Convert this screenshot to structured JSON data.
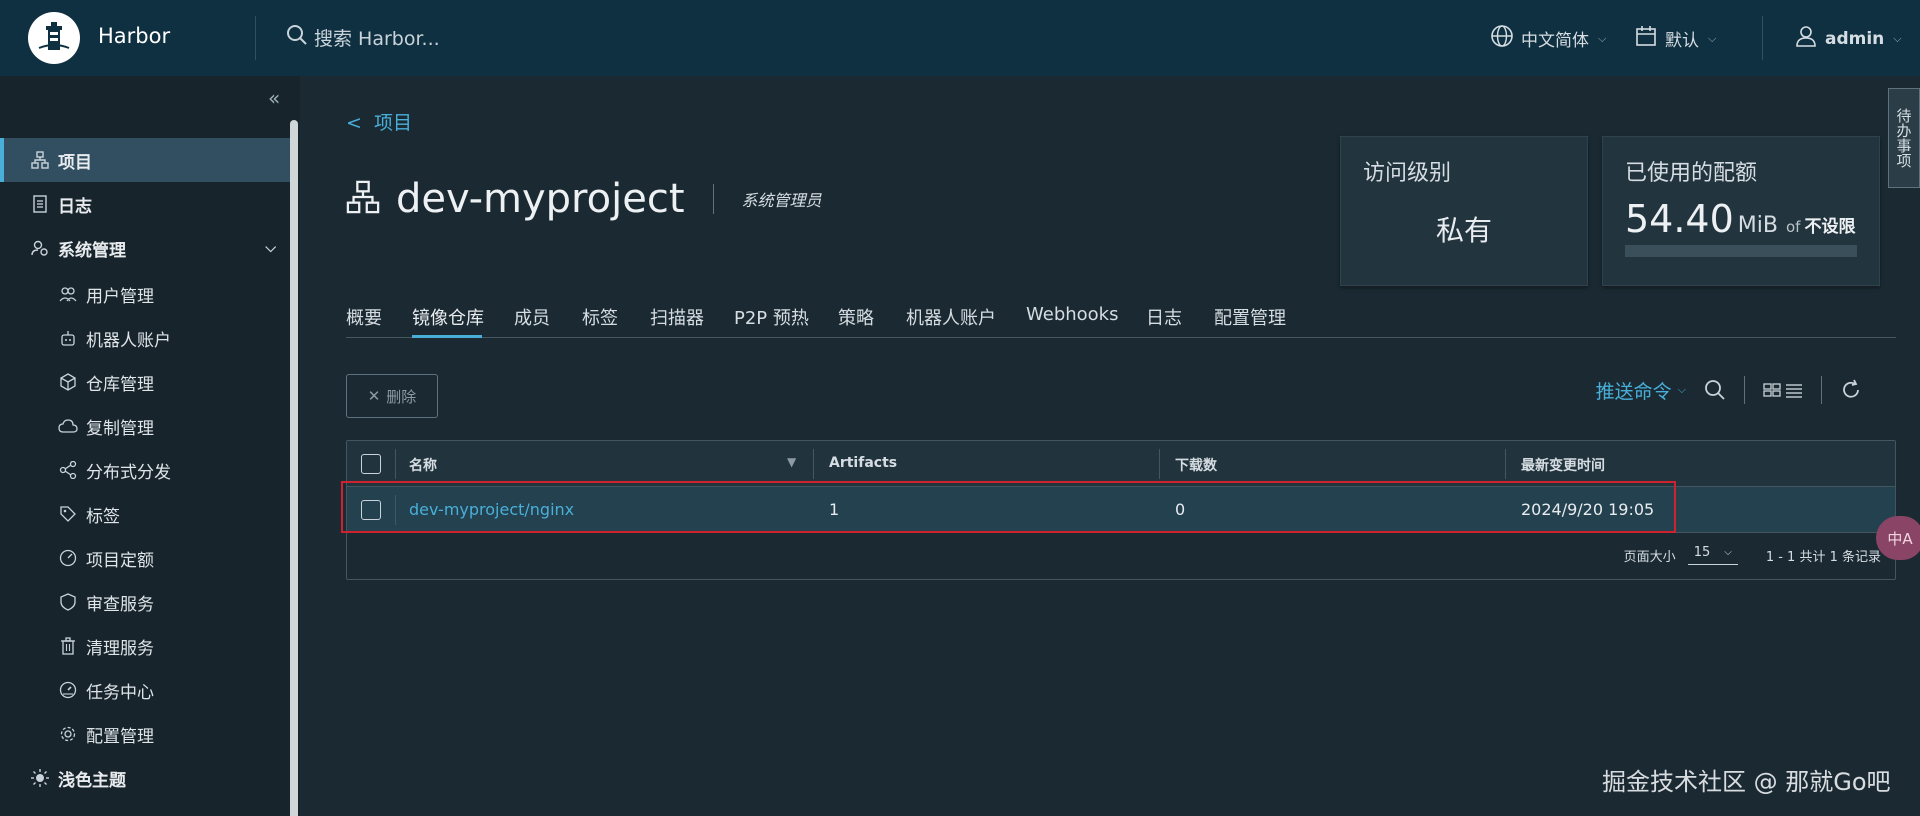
{
  "header": {
    "app_title": "Harbor",
    "search_placeholder": "搜索 Harbor...",
    "language": "中文简体",
    "datetime_format": "默认",
    "user": "admin"
  },
  "sidebar": {
    "items": [
      {
        "label": "项目",
        "icon": "project-icon"
      },
      {
        "label": "日志",
        "icon": "log-icon"
      },
      {
        "label": "系统管理",
        "icon": "system-admin-icon"
      },
      {
        "label": "用户管理",
        "icon": "users-icon"
      },
      {
        "label": "机器人账户",
        "icon": "robot-icon"
      },
      {
        "label": "仓库管理",
        "icon": "registry-icon"
      },
      {
        "label": "复制管理",
        "icon": "replication-icon"
      },
      {
        "label": "分布式分发",
        "icon": "distribution-icon"
      },
      {
        "label": "标签",
        "icon": "tag-icon"
      },
      {
        "label": "项目定额",
        "icon": "quota-icon"
      },
      {
        "label": "审查服务",
        "icon": "shield-icon"
      },
      {
        "label": "清理服务",
        "icon": "trash-icon"
      },
      {
        "label": "任务中心",
        "icon": "dashboard-icon"
      },
      {
        "label": "配置管理",
        "icon": "gear-icon"
      },
      {
        "label": "浅色主题",
        "icon": "sun-icon"
      }
    ]
  },
  "main": {
    "breadcrumb": "项目",
    "project_name": "dev-myproject",
    "role": "系统管理员",
    "access_card": {
      "title": "访问级别",
      "value": "私有"
    },
    "quota_card": {
      "title": "已使用的配额",
      "used": "54.40",
      "unit": "MiB",
      "of": "of",
      "limit": "不设限"
    },
    "tabs": [
      "概要",
      "镜像仓库",
      "成员",
      "标签",
      "扫描器",
      "P2P 预热",
      "策略",
      "机器人账户",
      "Webhooks",
      "日志",
      "配置管理"
    ],
    "active_tab": "镜像仓库",
    "delete_label": "删除",
    "push_command_label": "推送命令",
    "grid": {
      "columns": [
        "名称",
        "Artifacts",
        "下载数",
        "最新变更时间"
      ],
      "rows": [
        {
          "name": "dev-myproject/nginx",
          "artifacts": "1",
          "pulls": "0",
          "updated": "2024/9/20 19:05"
        }
      ],
      "page_size_label": "页面大小",
      "page_size": "15",
      "summary": "1 - 1 共计 1 条记录"
    }
  },
  "side_tab": "待办事项",
  "float_button": "中A",
  "watermark": "掘金技术社区 @ 那就Go吧",
  "colors": {
    "header_bg": "#0f3041",
    "accent": "#49afd9",
    "highlight": "#d0222e"
  }
}
